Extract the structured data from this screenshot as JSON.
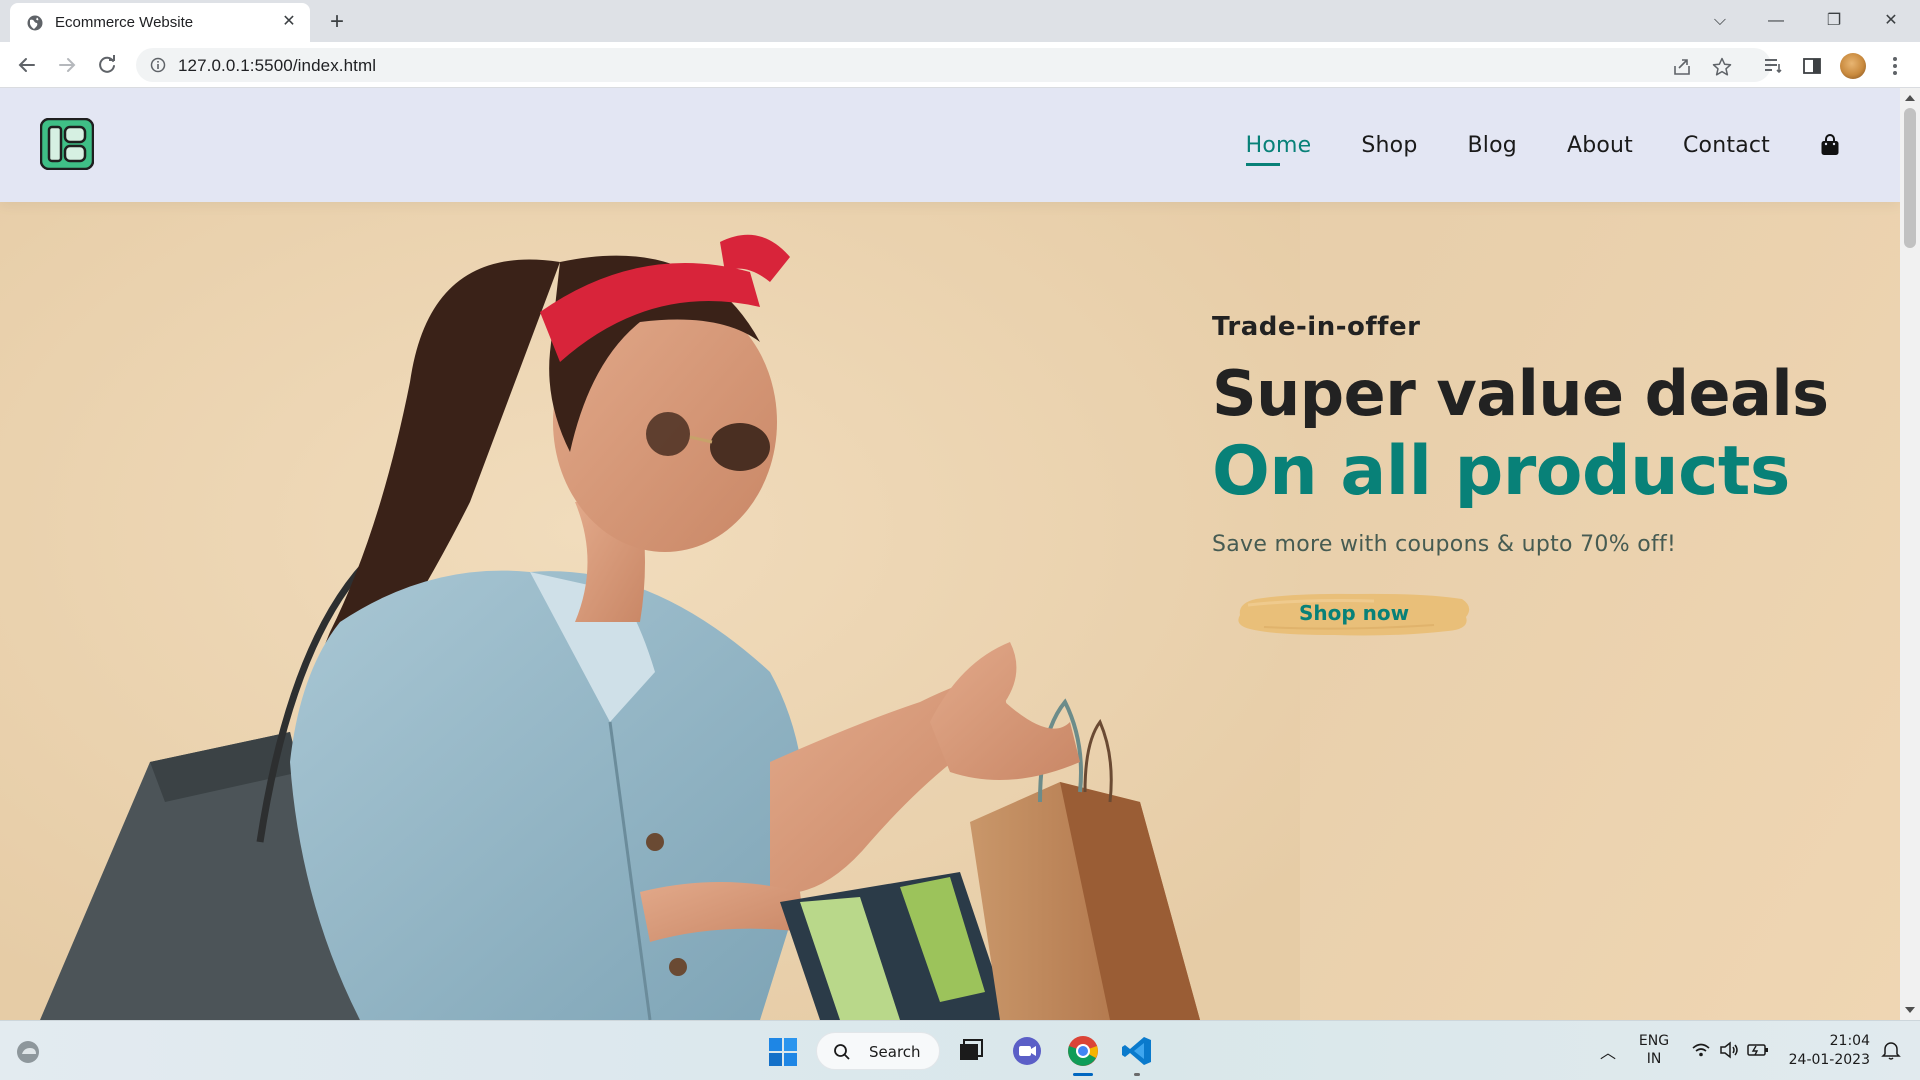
{
  "browser": {
    "tab_title": "Ecommerce Website",
    "url": "127.0.0.1:5500/index.html",
    "icons": [
      "globe-icon",
      "close-icon",
      "plus-icon",
      "back-icon",
      "forward-icon",
      "reload-icon",
      "info-icon",
      "share-icon",
      "star-icon",
      "reading-list-icon",
      "side-panel-icon",
      "menu-dots-icon"
    ]
  },
  "site": {
    "nav": {
      "home": "Home",
      "shop": "Shop",
      "blog": "Blog",
      "about": "About",
      "contact": "Contact",
      "active": "Home"
    },
    "hero": {
      "kicker": "Trade-in-offer",
      "headline": "Super value deals",
      "subheadline": "On all products",
      "tagline": "Save more with coupons & upto 70% off!",
      "button": "Shop now"
    },
    "colors": {
      "accent": "#088178",
      "header_bg": "#e3e6f3",
      "hero_bg": "#e8cfab",
      "button_brush": "#e9bf79"
    }
  },
  "taskbar": {
    "search_label": "Search",
    "lang_line1": "ENG",
    "lang_line2": "IN",
    "time": "21:04",
    "date": "24-01-2023"
  }
}
